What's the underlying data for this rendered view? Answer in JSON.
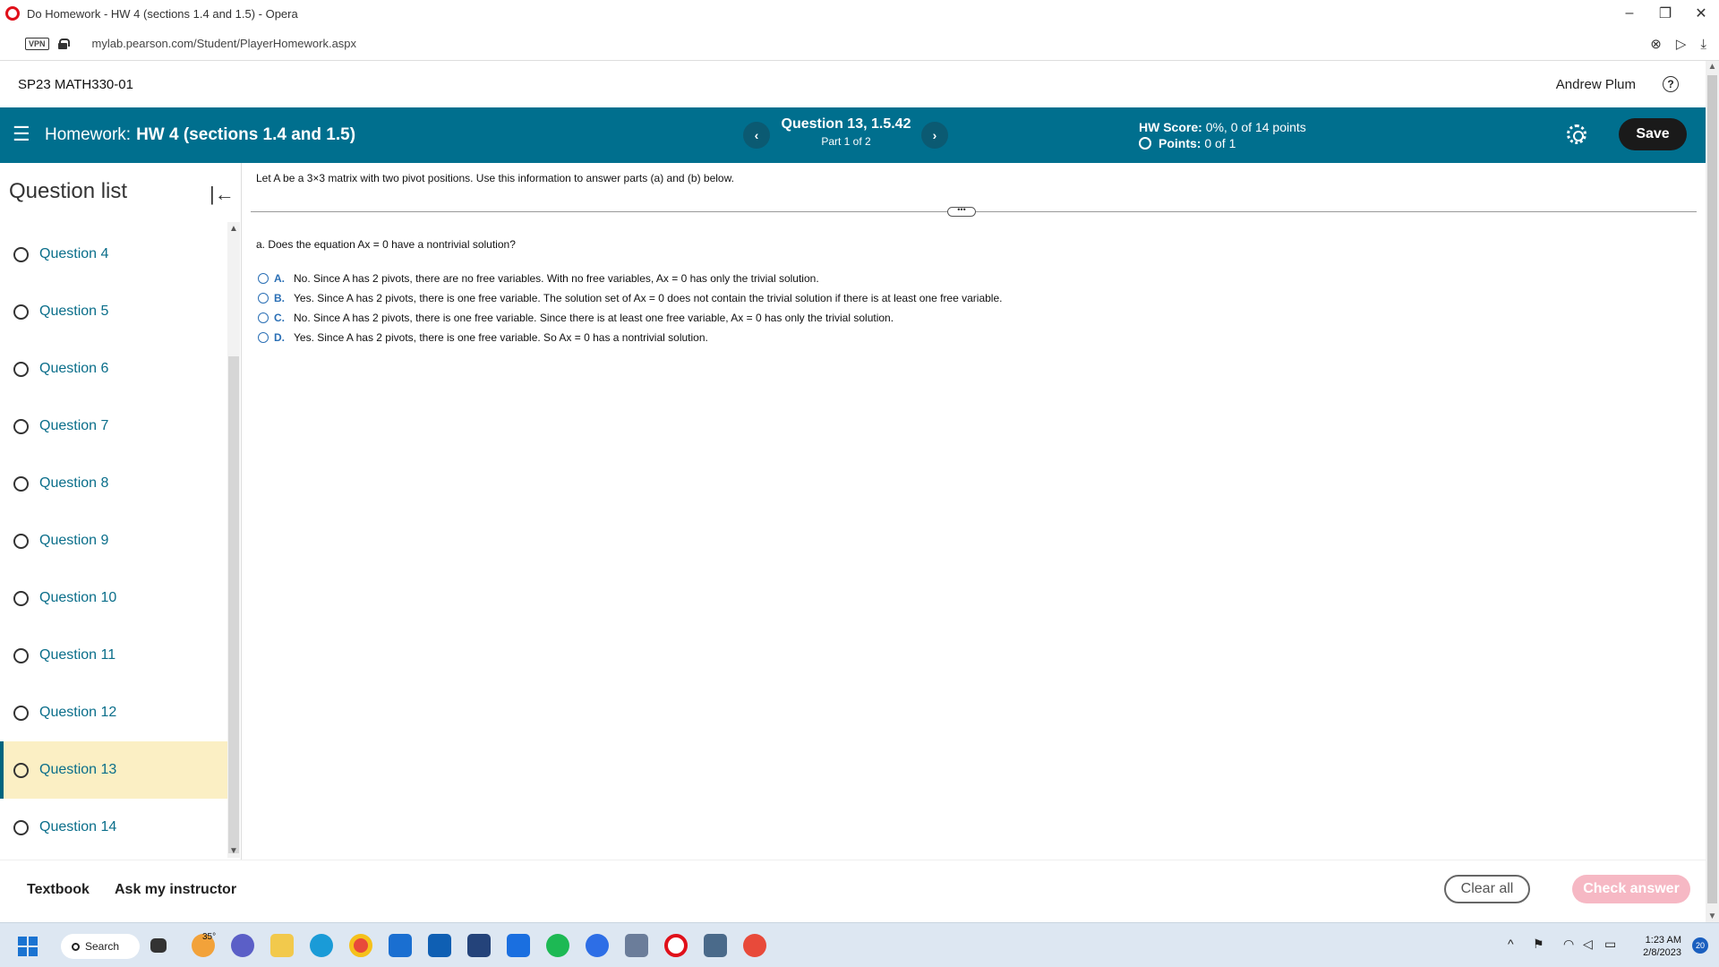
{
  "window": {
    "title": "Do Homework - HW 4 (sections 1.4 and 1.5) - Opera",
    "controls": [
      "minimize-icon",
      "restore-icon",
      "close-icon"
    ]
  },
  "addressbar": {
    "vpn_label": "VPN",
    "url": "mylab.pearson.com/Student/PlayerHomework.aspx"
  },
  "course": {
    "name": "SP23 MATH330-01",
    "user": "Andrew Plum",
    "help": "?"
  },
  "header": {
    "homework_label": "Homework:",
    "homework_name": "HW 4 (sections 1.4 and 1.5)",
    "question_title": "Question 13, 1.5.42",
    "part": "Part 1 of 2",
    "hw_score_label": "HW Score:",
    "hw_score_value": "0%, 0 of 14 points",
    "points_label": "Points:",
    "points_value": "0 of 1",
    "prev": "‹",
    "next": "›",
    "save_label": "Save"
  },
  "sidebar": {
    "heading": "Question list",
    "collapse": "|←",
    "items": [
      {
        "label": "Question 4"
      },
      {
        "label": "Question 5"
      },
      {
        "label": "Question 6"
      },
      {
        "label": "Question 7"
      },
      {
        "label": "Question 8"
      },
      {
        "label": "Question 9"
      },
      {
        "label": "Question 10"
      },
      {
        "label": "Question 11"
      },
      {
        "label": "Question 12"
      },
      {
        "label": "Question 13"
      },
      {
        "label": "Question 14"
      }
    ],
    "active_index": 9
  },
  "main": {
    "intro": "Let A be a 3×3 matrix with two pivot positions. Use this information to answer parts (a) and (b) below.",
    "expand": "•••",
    "part_a_question": "a. Does the equation Ax = 0 have a nontrivial solution?",
    "options": [
      {
        "letter": "A.",
        "text": "No. Since A has 2 pivots, there are no free variables. With no free variables, Ax = 0 has only the trivial solution."
      },
      {
        "letter": "B.",
        "text": "Yes. Since A has 2 pivots, there is one free variable. The solution set of Ax = 0 does not contain the trivial solution if there is at least one free variable."
      },
      {
        "letter": "C.",
        "text": "No. Since A has 2 pivots, there is one free variable. Since there is at least one free variable, Ax = 0 has only the trivial solution."
      },
      {
        "letter": "D.",
        "text": "Yes. Since A has 2 pivots, there is one free variable. So Ax = 0 has a nontrivial solution."
      }
    ]
  },
  "footer": {
    "textbook": "Textbook",
    "ask": "Ask my instructor",
    "clear_all": "Clear all",
    "check_answer": "Check answer"
  },
  "taskbar": {
    "search": "Search",
    "weather": "35°",
    "time": "1:23 AM",
    "date": "2/8/2023",
    "notifications": "20"
  },
  "colors": {
    "header_bg": "#006f8e",
    "link": "#0a6e8a",
    "active_item": "#fbefc4",
    "check_answer_bg": "#f6b8c4"
  }
}
